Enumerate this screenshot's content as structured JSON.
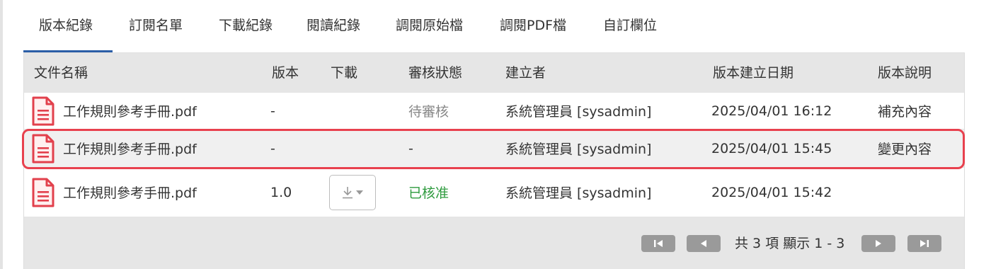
{
  "tabs": [
    {
      "label": "版本紀錄",
      "active": true
    },
    {
      "label": "訂閱名單",
      "active": false
    },
    {
      "label": "下載紀錄",
      "active": false
    },
    {
      "label": "閱讀紀錄",
      "active": false
    },
    {
      "label": "調閱原始檔",
      "active": false
    },
    {
      "label": "調閱PDF檔",
      "active": false
    },
    {
      "label": "自訂欄位",
      "active": false
    }
  ],
  "table": {
    "headers": {
      "file_name": "文件名稱",
      "version": "版本",
      "download": "下載",
      "review_status": "審核狀態",
      "creator": "建立者",
      "created_date": "版本建立日期",
      "description": "版本說明"
    },
    "rows": [
      {
        "file_name": "工作規則參考手冊.pdf",
        "version": "-",
        "review_status": "待審核",
        "creator": "系統管理員 [sysadmin]",
        "created_date": "2025/04/01 16:12",
        "description": "補充內容"
      },
      {
        "file_name": "工作規則參考手冊.pdf",
        "version": "-",
        "review_status": "-",
        "creator": "系統管理員 [sysadmin]",
        "created_date": "2025/04/01 15:45",
        "description": "變更內容"
      },
      {
        "file_name": "工作規則參考手冊.pdf",
        "version": "1.0",
        "review_status": "已核准",
        "creator": "系統管理員 [sysadmin]",
        "created_date": "2025/04/01 15:42",
        "description": ""
      }
    ]
  },
  "pager": {
    "summary": "共 3 項 顯示 1 - 3"
  },
  "colors": {
    "tab_active_underline": "#2b5ea7",
    "highlight_border": "#e8414e",
    "approved_status": "#2e9b3e",
    "pending_status": "#888888",
    "pdf_icon": "#e2404c"
  },
  "icons": [
    "file-pdf-icon",
    "download-icon",
    "caret-down-icon",
    "first-page-icon",
    "prev-page-icon",
    "next-page-icon",
    "last-page-icon"
  ]
}
